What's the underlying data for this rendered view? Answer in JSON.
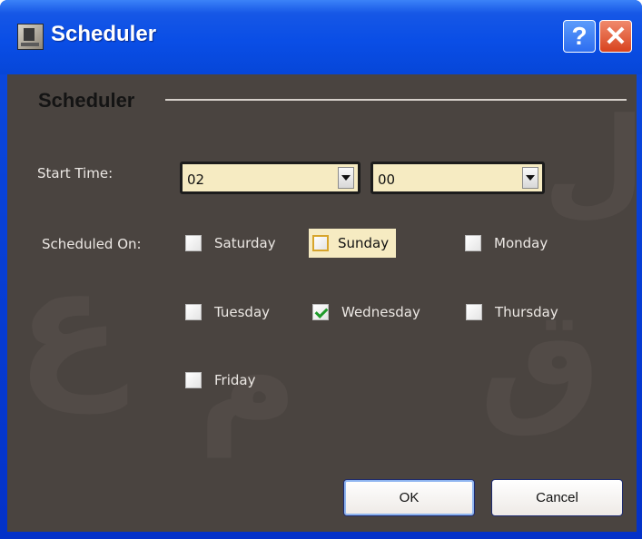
{
  "window": {
    "title": "Scheduler",
    "help_glyph": "?",
    "close_glyph": "✕"
  },
  "group": {
    "title": "Scheduler"
  },
  "start_time": {
    "label": "Start Time:",
    "hour": "02",
    "minute": "00"
  },
  "scheduled_on": {
    "label": "Scheduled On:",
    "days": [
      {
        "label": "Saturday",
        "checked": false
      },
      {
        "label": "Sunday",
        "checked": false,
        "focused": true
      },
      {
        "label": "Monday",
        "checked": false
      },
      {
        "label": "Tuesday",
        "checked": false
      },
      {
        "label": "Wednesday",
        "checked": true
      },
      {
        "label": "Thursday",
        "checked": false
      },
      {
        "label": "Friday",
        "checked": false
      }
    ]
  },
  "buttons": {
    "ok": "OK",
    "cancel": "Cancel"
  },
  "colors": {
    "title_bar": "#0a4ee6",
    "client_bg": "#4a4440",
    "combo_bg": "#f6ebc2",
    "check_mark": "#1f9a2a"
  }
}
